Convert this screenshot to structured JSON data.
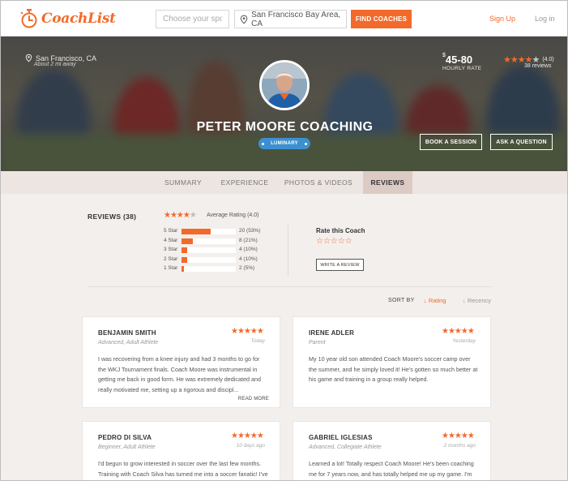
{
  "header": {
    "logo_text": "CoachList",
    "sport_placeholder": "Choose your sport",
    "location_value": "San Francisco Bay Area, CA",
    "find_button": "FIND COACHES",
    "signup": "Sign Up",
    "login": "Log in",
    "brand_color": "#f26a2b"
  },
  "hero": {
    "location": "San Francisco, CA",
    "location_sub": "About 2 mi away",
    "rate_currency": "$",
    "rate_range": "45-80",
    "rate_label": "HOURLY RATE",
    "rating_stars": 4,
    "rating_text": "(4.0)",
    "review_count": "38 reviews",
    "coach_name": "PETER MOORE COACHING",
    "badge": "LUMINARY",
    "book_button": "BOOK A SESSION",
    "ask_button": "ASK A QUESTION"
  },
  "tabs": [
    {
      "label": "SUMMARY",
      "active": false
    },
    {
      "label": "EXPERIENCE",
      "active": false
    },
    {
      "label": "PHOTOS & VIDEOS",
      "active": false
    },
    {
      "label": "REVIEWS",
      "active": true
    }
  ],
  "reviews_summary": {
    "title": "REVIEWS  (38)",
    "average_stars": 4,
    "average_label": "Average Rating (4.0)",
    "distribution": [
      {
        "label": "5 Star",
        "count": "20 (53%)",
        "fraction": 0.53
      },
      {
        "label": "4 Star",
        "count": "8 (21%)",
        "fraction": 0.21
      },
      {
        "label": "3 Star",
        "count": "4 (10%)",
        "fraction": 0.1
      },
      {
        "label": "2 Star",
        "count": "4 (10%)",
        "fraction": 0.1
      },
      {
        "label": "1 Star",
        "count": "2  (5%)",
        "fraction": 0.05
      }
    ],
    "rate_this_title": "Rate this Coach",
    "write_review_button": "WRITE A REVIEW"
  },
  "sort": {
    "label": "SORT BY",
    "rating": "↓ Rating",
    "recency": "↓ Recency"
  },
  "reviews": [
    {
      "name": "BENJAMIN SMITH",
      "role": "Advanced, Adult Athlete",
      "when": "Today",
      "stars": 5,
      "text": "I was recovering from a knee injury and had 3 months to go for the WKJ Tournament finals. Coach Moore was instrumental in getting me back in good form. He was extremely dedicated and really motivated me, setting up a rigorous and discipl...",
      "more": "READ MORE"
    },
    {
      "name": "IRENE ADLER",
      "role": "Parent",
      "when": "Yesterday",
      "stars": 5,
      "text": "My 10 year old son attended Coach Moore's soccer camp over the summer, and he simply loved it! He's gotten so much better at his game and training in a group really helped.",
      "more": ""
    },
    {
      "name": "PEDRO DI SILVA",
      "role": "Beginner, Adult Athlete",
      "when": "10 days ago",
      "stars": 5,
      "text": "I'd begun to grow interested in soccer over the last few months. Training with Coach Silva has turned me into a soccer fanatic! I've learned a lot and I'm now able to play with my friends",
      "more": ""
    },
    {
      "name": "GABRIEL IGLESIAS",
      "role": "Advanced, Collegiate Athlete",
      "when": "2 months ago",
      "stars": 5,
      "text": "Learned a lot! Totally respect Coach Moore! He's been coaching me for 7 years now, and has totally helped me up my game. I'm now on the college varsity team.",
      "more": ""
    }
  ]
}
